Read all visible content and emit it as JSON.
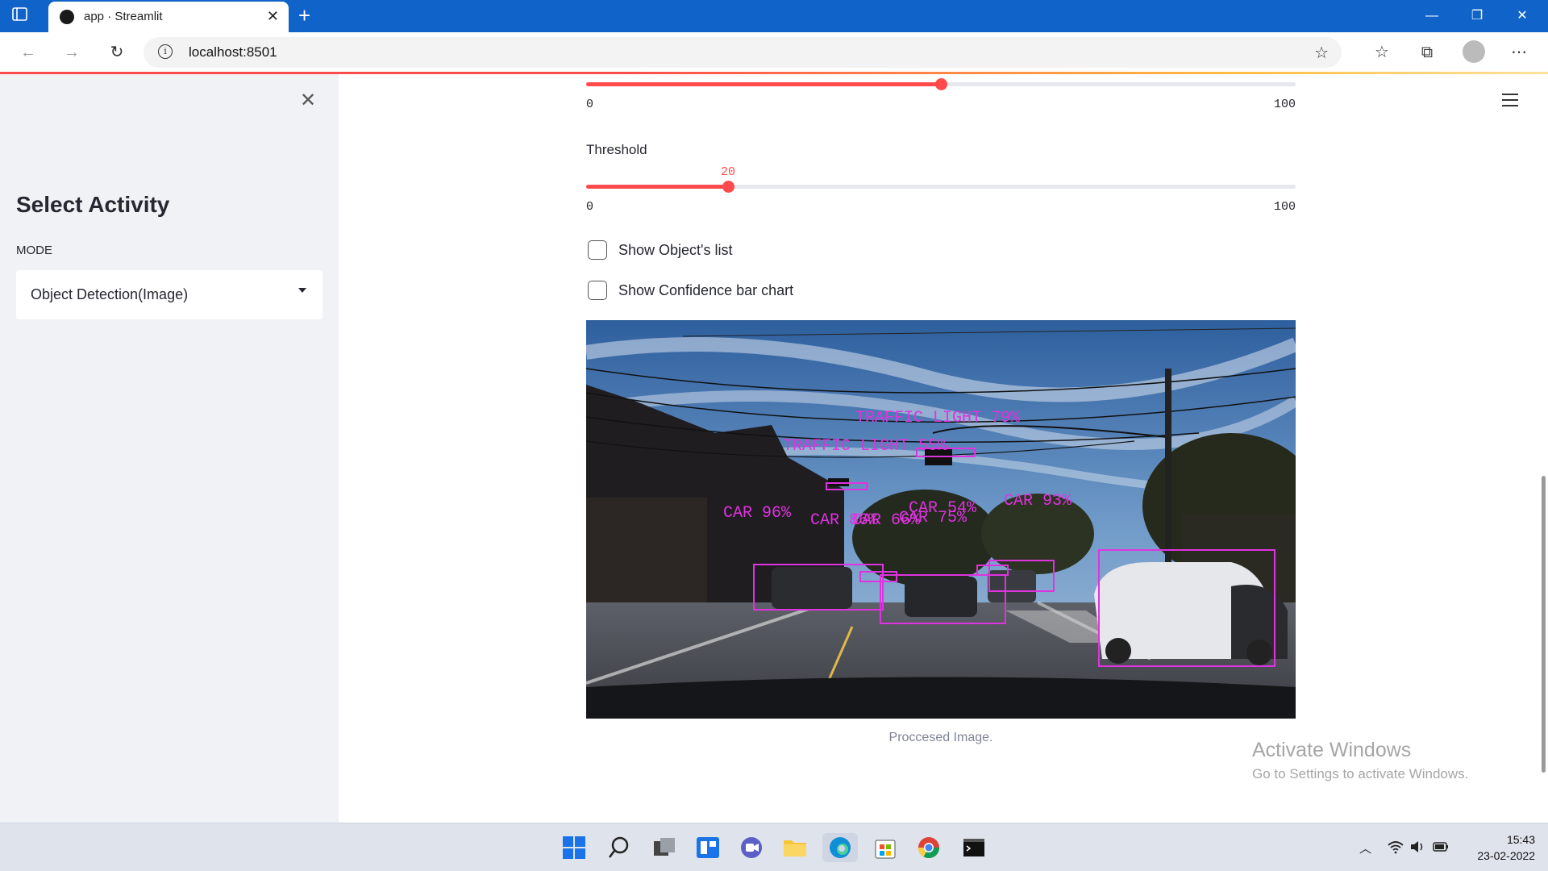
{
  "browser": {
    "tab_title": "app · Streamlit",
    "tab_close": "✕",
    "new_tab": "+",
    "url": "localhost:8501",
    "window_controls": [
      "—",
      "❐",
      "✕"
    ]
  },
  "sidebar": {
    "close": "✕",
    "heading": "Select Activity",
    "mode_label": "MODE",
    "mode_value": "Object Detection(Image)"
  },
  "main": {
    "slider1": {
      "value": 50,
      "min": "0",
      "max": "100"
    },
    "threshold": {
      "label": "Threshold",
      "value": 20,
      "value_text": "20",
      "min": "0",
      "max": "100"
    },
    "checkboxes": [
      {
        "label": "Show Object's list",
        "checked": false
      },
      {
        "label": "Show Confidence bar chart",
        "checked": false
      }
    ],
    "image_caption": "Proccesed Image.",
    "detections": [
      {
        "label": "TRAFFIC LIGHT 79%"
      },
      {
        "label": "TRAFFIC LIGHT 55%"
      },
      {
        "label": "CAR 96%"
      },
      {
        "label": "CAR 86%"
      },
      {
        "label": "CAR 66%"
      },
      {
        "label": "CAR 54%"
      },
      {
        "label": "CAR 75%"
      },
      {
        "label": "CAR 93%"
      }
    ]
  },
  "watermark": {
    "line1": "Activate Windows",
    "line2": "Go to Settings to activate Windows."
  },
  "taskbar": {
    "time": "15:43",
    "date": "23-02-2022"
  },
  "colors": {
    "accent": "#ff4b4b",
    "browser_blue": "#1063c8",
    "sidebar_bg": "#f0f2f6",
    "detection_box": "#e033e0"
  }
}
